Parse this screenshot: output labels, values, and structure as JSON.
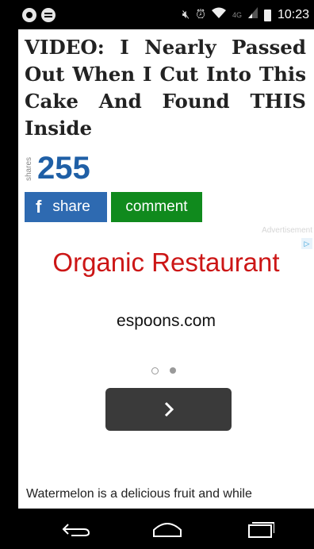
{
  "status_bar": {
    "time": "10:23",
    "network": "4G",
    "icons": [
      "chrome-icon",
      "spotify-icon",
      "mute-icon",
      "alarm-icon",
      "wifi-icon",
      "signal-icon",
      "battery-icon"
    ]
  },
  "article": {
    "headline": "VIDEO: I Nearly Passed Out When I Cut Into This Cake And Found THIS Inside",
    "shares_label": "shares",
    "shares_count": "255",
    "share_button": "share",
    "comment_button": "comment",
    "body_preview": "Watermelon is a delicious fruit and while"
  },
  "ad": {
    "label": "Advertisement",
    "headline": "Organic Restaurant",
    "domain": "espoons.com",
    "carousel": {
      "pages": 2,
      "active": 2
    }
  },
  "colors": {
    "headline": "#222222",
    "shares": "#1f5fa6",
    "facebook": "#2e6ab1",
    "comment": "#108a1d",
    "ad_headline": "#cc1616",
    "next_button": "#3a3a3a"
  },
  "nav_bar": {
    "icons": [
      "back-icon",
      "home-icon",
      "recents-icon"
    ]
  }
}
